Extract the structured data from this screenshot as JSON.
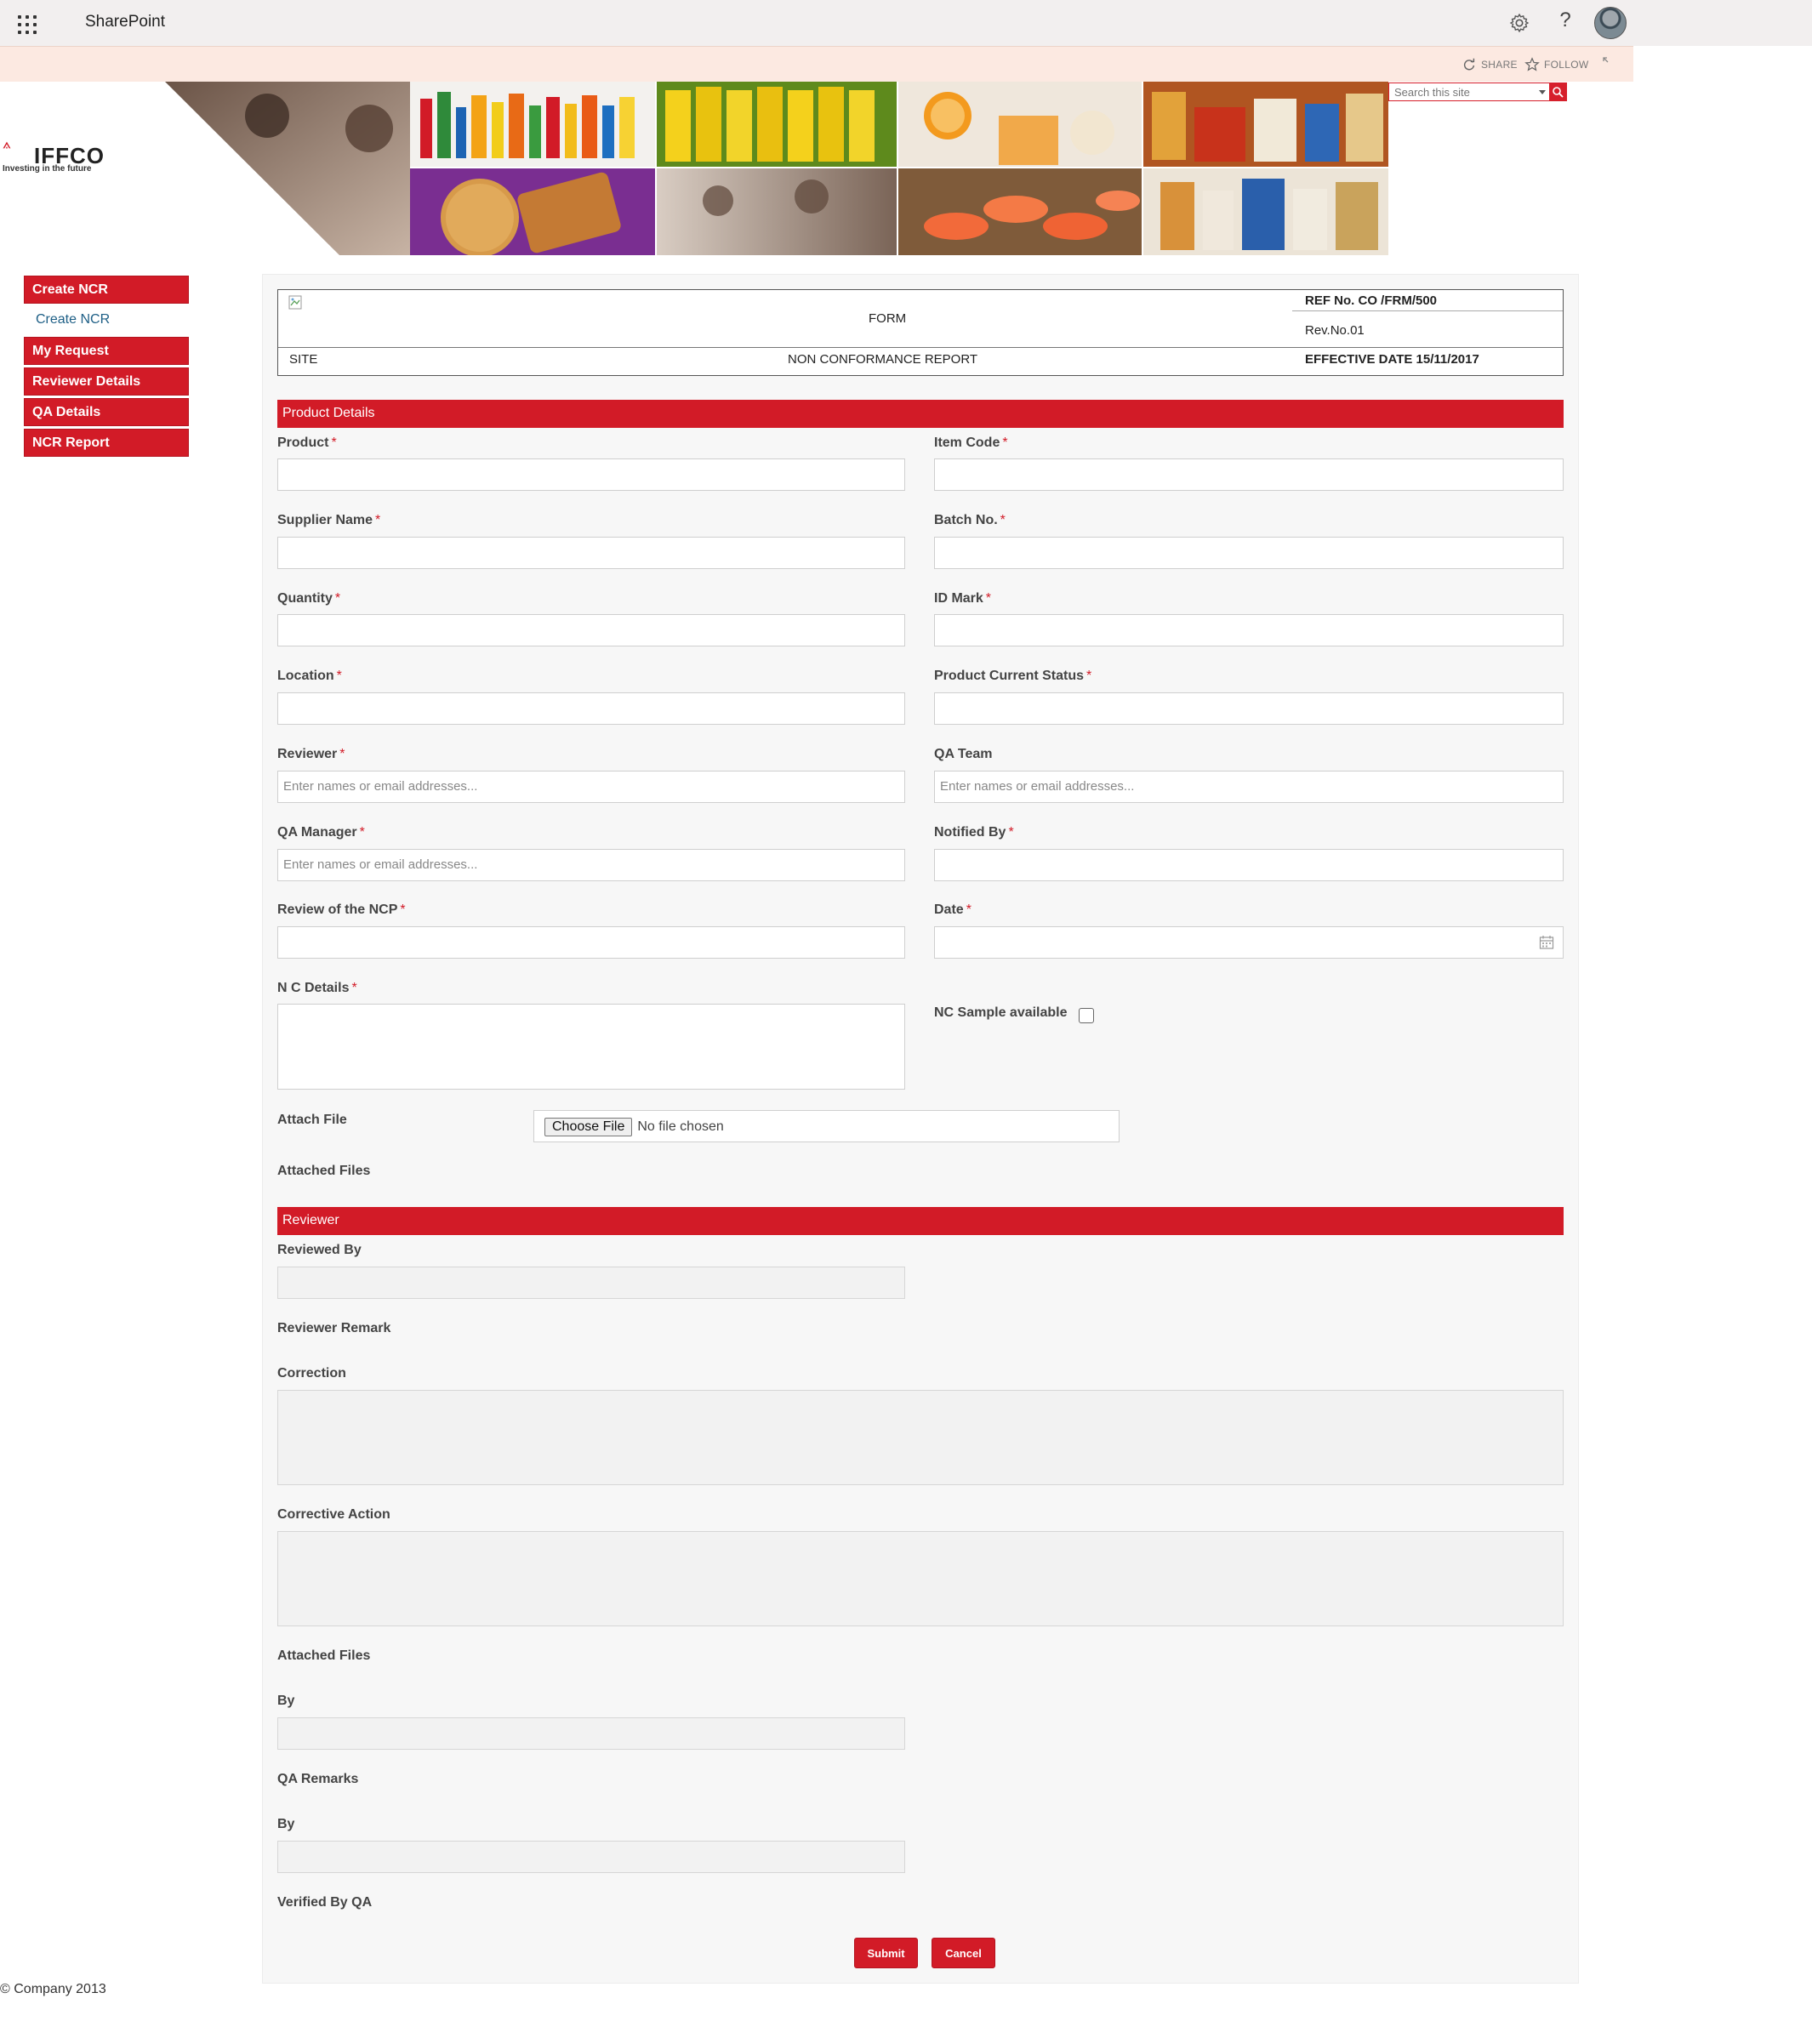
{
  "suitebar": {
    "brand": "SharePoint"
  },
  "actions": {
    "share": "SHARE",
    "follow": "FOLLOW"
  },
  "search": {
    "placeholder": "Search this site"
  },
  "logo": {
    "name": "IFFCO",
    "tagline": "Investing in the future"
  },
  "nav": {
    "items": [
      {
        "label": "Create NCR",
        "type": "head"
      },
      {
        "label": "Create NCR",
        "type": "sub"
      },
      {
        "label": "My Request",
        "type": "head"
      },
      {
        "label": "Reviewer Details",
        "type": "head"
      },
      {
        "label": "QA Details",
        "type": "head"
      },
      {
        "label": "NCR Report",
        "type": "head"
      }
    ]
  },
  "header": {
    "form": "FORM",
    "ref_no": "REF No. CO /FRM/500",
    "rev_no": "Rev.No.01",
    "site": "SITE",
    "report": "NON CONFORMANCE REPORT",
    "effective_date": "EFFECTIVE DATE 15/11/2017"
  },
  "sections": {
    "product": "Product Details",
    "reviewer": "Reviewer"
  },
  "people_placeholder": "Enter names or email addresses...",
  "fields": {
    "product": "Product",
    "item_code": "Item Code",
    "supplier_name": "Supplier Name",
    "batch_no": "Batch No.",
    "quantity": "Quantity",
    "id_mark": "ID Mark",
    "location": "Location",
    "product_status": "Product Current Status",
    "reviewer": "Reviewer",
    "qa_team": "QA Team",
    "qa_manager": "QA Manager",
    "notified_by": "Notified By",
    "review_ncp": "Review of the NCP",
    "date": "Date",
    "nc_details": "N C Details",
    "nc_sample": "NC Sample available",
    "attach_file": "Attach File",
    "attached_files": "Attached Files"
  },
  "file_input": {
    "button": "Choose File",
    "status": "No file chosen"
  },
  "reviewer_fields": {
    "reviewed_by": "Reviewed By",
    "reviewer_remark": "Reviewer Remark",
    "correction": "Correction",
    "corrective_action": "Corrective Action",
    "attached_files": "Attached Files",
    "by_1": "By",
    "qa_remarks": "QA Remarks",
    "by_2": "By",
    "verified_by_qa": "Verified By QA"
  },
  "buttons": {
    "submit": "Submit",
    "cancel": "Cancel"
  },
  "footer": {
    "copyright": "© Company 2013"
  },
  "colors": {
    "accent": "#d21b27",
    "suitebar": "#f2efef",
    "actionbar": "#fce9e1"
  },
  "required_mark": "*"
}
